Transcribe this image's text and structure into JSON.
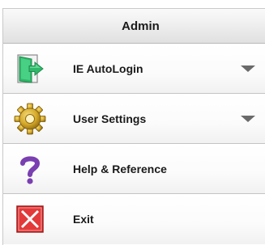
{
  "header": {
    "title": "Admin"
  },
  "items": [
    {
      "label": "IE AutoLogin",
      "icon": "autologin-door-icon",
      "has_dropdown": true
    },
    {
      "label": "User Settings",
      "icon": "gear-icon",
      "has_dropdown": true
    },
    {
      "label": "Help & Reference",
      "icon": "question-mark-icon",
      "has_dropdown": false
    },
    {
      "label": "Exit",
      "icon": "close-x-icon",
      "has_dropdown": false
    }
  ],
  "colors": {
    "autologin_green": "#2fb86a",
    "gear_gold": "#d4a82a",
    "help_purple": "#7a3fb0",
    "exit_red": "#e23a3a"
  }
}
